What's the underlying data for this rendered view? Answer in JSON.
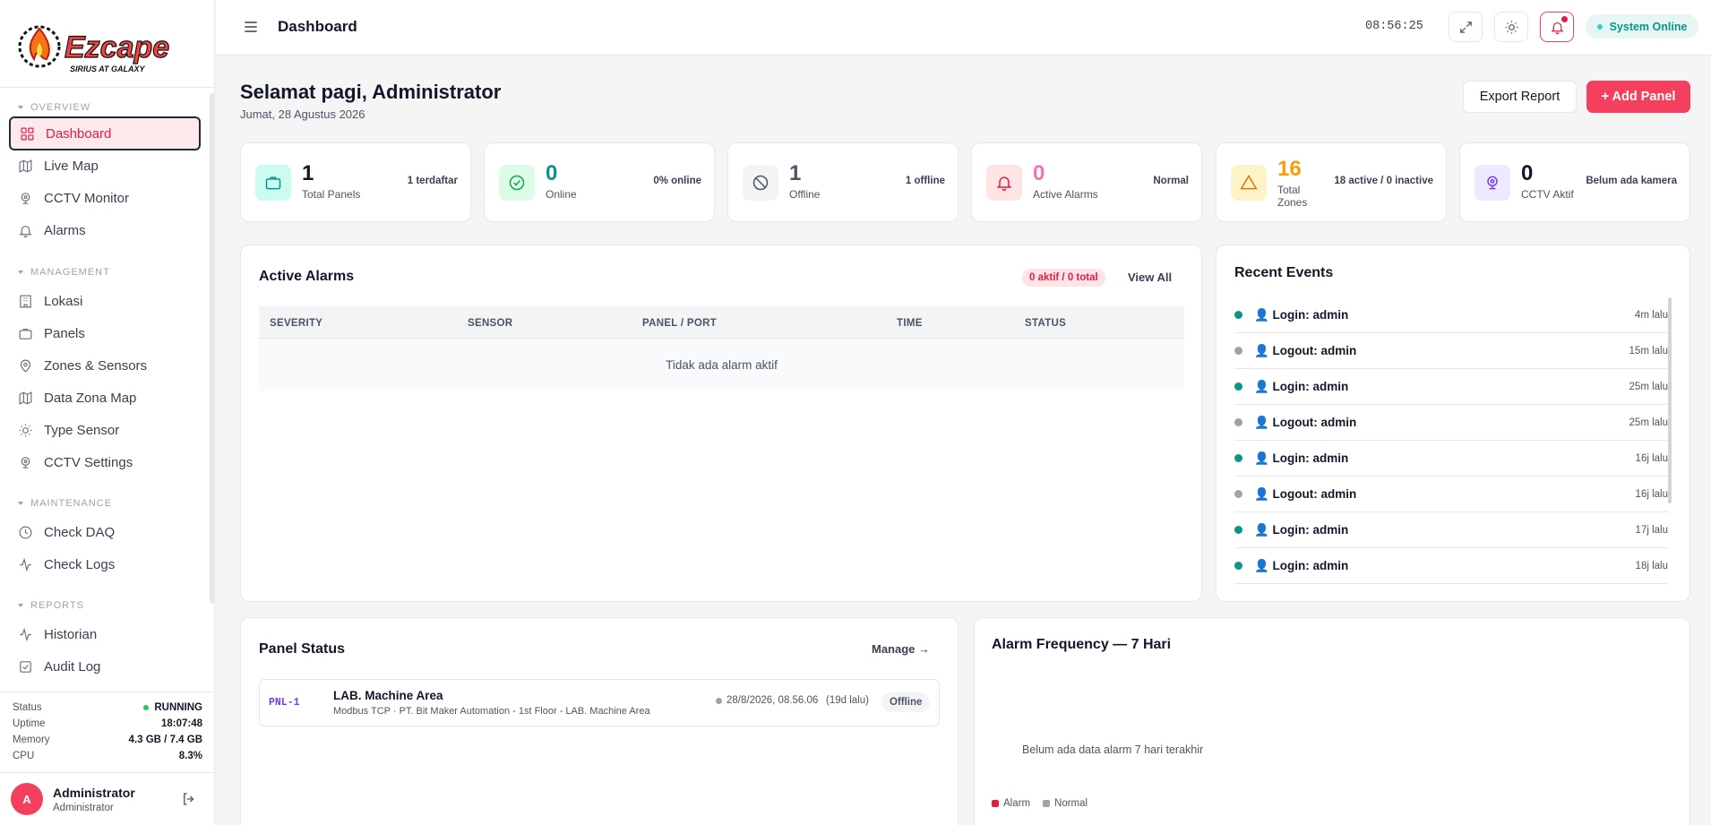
{
  "app": {
    "brand": "Ezcape",
    "tagline": "SIRIUS AT GALAXY"
  },
  "topbar": {
    "title": "Dashboard",
    "clock": "08:56:25",
    "system_status": "System Online"
  },
  "sidebar": {
    "sections": {
      "overview": "OVERVIEW",
      "management": "MANAGEMENT",
      "maintenance": "MAINTENANCE",
      "reports": "REPORTS"
    },
    "items": [
      {
        "label": "Dashboard",
        "icon": "grid-icon",
        "active": true
      },
      {
        "label": "Live Map",
        "icon": "map-icon"
      },
      {
        "label": "CCTV Monitor",
        "icon": "cctv-icon"
      },
      {
        "label": "Alarms",
        "icon": "bell-icon"
      },
      {
        "label": "Lokasi",
        "icon": "building-icon"
      },
      {
        "label": "Panels",
        "icon": "briefcase-icon"
      },
      {
        "label": "Zones & Sensors",
        "icon": "pin-icon"
      },
      {
        "label": "Data Zona Map",
        "icon": "map-icon"
      },
      {
        "label": "Type Sensor",
        "icon": "sun-icon"
      },
      {
        "label": "CCTV Settings",
        "icon": "cctv-icon"
      },
      {
        "label": "Check DAQ",
        "icon": "clock-icon"
      },
      {
        "label": "Check Logs",
        "icon": "activity-icon"
      },
      {
        "label": "Historian",
        "icon": "activity-icon"
      },
      {
        "label": "Audit Log",
        "icon": "checklist-icon"
      }
    ]
  },
  "system": {
    "status_label": "Status",
    "status_value": "RUNNING",
    "uptime_label": "Uptime",
    "uptime_value": "18:07:48",
    "memory_label": "Memory",
    "memory_value": "4.3 GB / 7.4 GB",
    "cpu_label": "CPU",
    "cpu_value": "8.3%"
  },
  "user": {
    "initial": "A",
    "name": "Administrator",
    "role": "Administrator"
  },
  "greeting": {
    "title": "Selamat pagi, Administrator",
    "date": "Jumat, 28 Agustus 2026"
  },
  "actions": {
    "export": "Export Report",
    "add_panel": "+ Add Panel"
  },
  "stats": [
    {
      "value": "1",
      "label": "Total Panels",
      "side": "1 terdaftar",
      "color": "#111827",
      "icon": "briefcase-icon",
      "bg": "#ccfbf1",
      "stroke": "#0d9488"
    },
    {
      "value": "0",
      "label": "Online",
      "side": "0% online",
      "color": "#0d9488",
      "icon": "check-circle-icon",
      "bg": "#dcfce7",
      "stroke": "#16a34a"
    },
    {
      "value": "1",
      "label": "Offline",
      "side": "1 offline",
      "color": "#4b5563",
      "icon": "ban-icon",
      "bg": "#f3f4f6",
      "stroke": "#4b5563"
    },
    {
      "value": "0",
      "label": "Active Alarms",
      "side": "Normal",
      "color": "#f472b6",
      "icon": "bell-icon",
      "bg": "#ffe4e6",
      "stroke": "#e11d48"
    },
    {
      "value": "16",
      "label": "Total Zones",
      "side": "18 active / 0 inactive",
      "color": "#f59e0b",
      "icon": "warning-icon",
      "bg": "#fef3c7",
      "stroke": "#d97706"
    },
    {
      "value": "0",
      "label": "CCTV Aktif",
      "side": "Belum ada kamera",
      "color": "#111827",
      "icon": "cctv-icon",
      "bg": "#ede9fe",
      "stroke": "#7c3aed"
    }
  ],
  "alarms": {
    "title": "Active Alarms",
    "badge": "0 aktif / 0 total",
    "view_all": "View All",
    "columns": [
      "SEVERITY",
      "SENSOR",
      "PANEL / PORT",
      "TIME",
      "STATUS"
    ],
    "empty": "Tidak ada alarm aktif"
  },
  "events": {
    "title": "Recent Events",
    "items": [
      {
        "text": "👤 Login: admin",
        "time": "4m lalu",
        "color": "#0d9488"
      },
      {
        "text": "👤 Logout: admin",
        "time": "15m lalu",
        "color": "#9ca3af"
      },
      {
        "text": "👤 Login: admin",
        "time": "25m lalu",
        "color": "#0d9488"
      },
      {
        "text": "👤 Logout: admin",
        "time": "25m lalu",
        "color": "#9ca3af"
      },
      {
        "text": "👤 Login: admin",
        "time": "16j lalu",
        "color": "#0d9488"
      },
      {
        "text": "👤 Logout: admin",
        "time": "16j lalu",
        "color": "#9ca3af"
      },
      {
        "text": "👤 Login: admin",
        "time": "17j lalu",
        "color": "#0d9488"
      },
      {
        "text": "👤 Login: admin",
        "time": "18j lalu",
        "color": "#0d9488"
      }
    ]
  },
  "panel_status": {
    "title": "Panel Status",
    "manage": "Manage →",
    "rows": [
      {
        "code": "PNL-1",
        "name": "LAB. Machine Area",
        "detail": "Modbus TCP · PT. Bit Maker Automation - 1st Floor - LAB. Machine Area",
        "timestamp": "28/8/2026, 08.56.06",
        "ago": "(19d lalu)",
        "status": "Offline"
      }
    ]
  },
  "frequency": {
    "title": "Alarm Frequency — 7 Hari",
    "empty": "Belum ada data alarm 7 hari terakhir",
    "legend": [
      {
        "label": "Alarm",
        "color": "#e11d48"
      },
      {
        "label": "Normal",
        "color": "#9ca3af"
      }
    ]
  }
}
